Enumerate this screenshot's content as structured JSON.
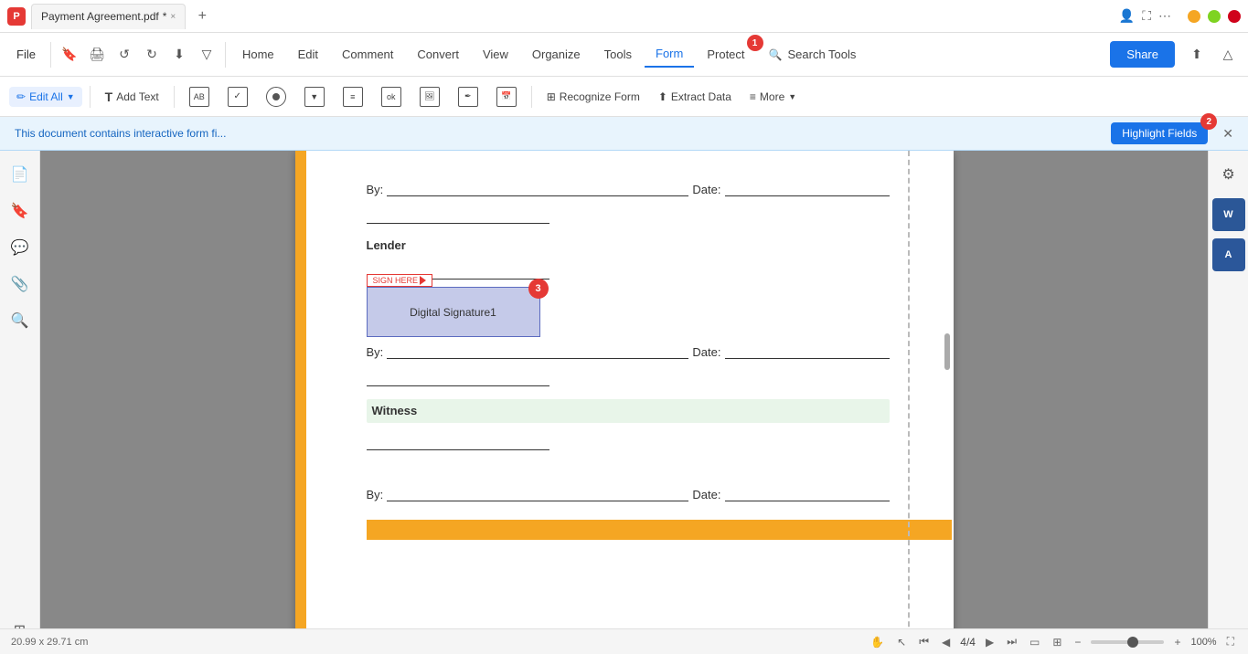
{
  "titlebar": {
    "app_icon": "P",
    "tab_label": "Payment Agreement.pdf",
    "tab_modified": "*",
    "close_label": "×",
    "add_tab": "+"
  },
  "menubar": {
    "file_label": "File",
    "nav_items": [
      "Home",
      "Edit",
      "Comment",
      "Convert",
      "View",
      "Organize",
      "Tools",
      "Form",
      "Protect"
    ],
    "active_item": "Form",
    "search_placeholder": "Search Tools",
    "share_label": "Share"
  },
  "toolbar": {
    "edit_all_label": "Edit All",
    "add_text_label": "Add Text",
    "recognize_form_label": "Recognize Form",
    "extract_data_label": "Extract Data",
    "more_label": "More"
  },
  "notification": {
    "text": "This document contains interactive form fi...",
    "highlight_btn": "Highlight Fields",
    "badge_number": "2"
  },
  "badges": {
    "badge1": "1",
    "badge2": "2",
    "badge3": "3"
  },
  "pdf": {
    "lender_label": "Lender",
    "by_label": "By:",
    "date_label": "Date:",
    "witness_label": "Witness",
    "sign_here_label": "SIGN HERE",
    "digital_sig_label": "Digital Signature1"
  },
  "statusbar": {
    "dimensions": "20.99 x 29.71 cm",
    "page_current": "4",
    "page_total": "4",
    "zoom_level": "100%"
  },
  "right_panel": {
    "icon1": "⚙",
    "icon2": "W",
    "icon3": "A"
  }
}
